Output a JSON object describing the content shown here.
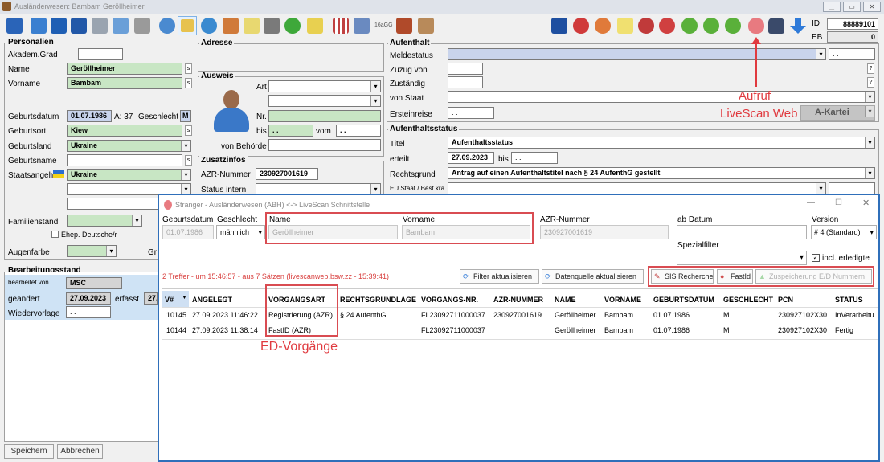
{
  "window": {
    "title": "Ausländerwesen: Bambam Geröllheimer",
    "win_min": "▁",
    "win_max": "▭",
    "win_close": "✕"
  },
  "toolbar": {
    "id_label": "ID",
    "id_value": "88889101",
    "eb_label": "EB",
    "eb_value": "0",
    "ldap_label": "16aGG"
  },
  "personalien": {
    "title": "Personalien",
    "akadem_label": "Akadem.Grad",
    "name_label": "Name",
    "name_value": "Geröllheimer",
    "vorname_label": "Vorname",
    "vorname_value": "Bambam",
    "geburtsdatum_label": "Geburtsdatum",
    "geburtsdatum_value": "01.07.1986",
    "alter": "A: 37",
    "geschlecht_label": "Geschlecht",
    "geschlecht_value": "M",
    "geburtsort_label": "Geburtsort",
    "geburtsort_value": "Kiew",
    "geburtsland_label": "Geburtsland",
    "geburtsland_value": "Ukraine",
    "geburtsname_label": "Geburtsname",
    "staatsangeh_label": "Staatsangeh.",
    "staatsangeh_value": "Ukraine",
    "familienstand_label": "Familienstand",
    "ehep_label": "Ehep. Deutsche/r",
    "augenfarbe_label": "Augenfarbe",
    "gr_label": "Gr"
  },
  "adresse": {
    "title": "Adresse"
  },
  "ausweis": {
    "title": "Ausweis",
    "art_label": "Art",
    "nr_label": "Nr.",
    "bis_label": "bis",
    "bis_value": ". .",
    "vom_label": "vom",
    "vom_value": ". .",
    "behoerde_label": "von Behörde"
  },
  "zusatz": {
    "title": "Zusatzinfos",
    "azr_label": "AZR-Nummer",
    "azr_value": "230927001619",
    "status_label": "Status intern"
  },
  "aufenthalt": {
    "title": "Aufenthalt",
    "meldestatus_label": "Meldestatus",
    "meldestatus_date": ". .",
    "zuzug_label": "Zuzug von",
    "zustaendig_label": "Zuständig",
    "vonstaat_label": "von Staat",
    "ersteinreise_label": "Ersteinreise",
    "ersteinreise_value": ". .",
    "akartei": "A-Kartei"
  },
  "status": {
    "title": "Aufenthaltsstatus",
    "titel_label": "Titel",
    "titel_value": "Aufenthaltsstatus",
    "erteilt_label": "erteilt",
    "erteilt_value": "27.09.2023",
    "bis_label": "bis",
    "bis_value": ". .",
    "rechtsgrund_label": "Rechtsgrund",
    "rechtsgrund_value": "Antrag auf einen Aufenthaltstitel nach § 24 AufenthG gestellt",
    "eu_label": "EU Staat / Best.kra",
    "eu_date": ". ."
  },
  "bearbeitung": {
    "title": "Bearbeitungsstand",
    "bearbeitet_label": "bearbeitet von",
    "bearbeitet_value": "MSC",
    "geaendert_label": "geändert",
    "geaendert_value": "27.09.2023",
    "erfasst_label": "erfasst",
    "erfasst_value": "27.",
    "wiedervorlage_label": "Wiedervorlage",
    "wiedervorlage_value": ". ."
  },
  "buttons": {
    "speichern": "Speichern",
    "abbrechen": "Abbrechen"
  },
  "annotations": {
    "aufruf": "Aufruf",
    "livescan": "LiveScan Web",
    "ed": "ED-Vorgänge"
  },
  "dialog": {
    "title": "Stranger - Ausländerwesen (ABH) <-> LiveScan Schnittstelle",
    "geburtsdatum_label": "Geburtsdatum",
    "geburtsdatum_value": "01.07.1986",
    "geschlecht_label": "Geschlecht",
    "geschlecht_value": "männlich",
    "name_label": "Name",
    "name_value": "Geröllheimer",
    "vorname_label": "Vorname",
    "vorname_value": "Bambam",
    "azr_label": "AZR-Nummer",
    "azr_value": "230927001619",
    "abdatum_label": "ab Datum",
    "version_label": "Version",
    "version_value": "# 4 (Standard)",
    "spezialfilter_label": "Spezialfilter",
    "incl_label": "incl. erledigte",
    "status_text": "2 Treffer -  um 15:46:57 - aus 7 Sätzen (livescanweb.bsw.zz - 15:39:41)",
    "btn_filter": "Filter aktualisieren",
    "btn_datenquelle": "Datenquelle aktualisieren",
    "btn_sis": "SIS Recherche",
    "btn_fastid": "FastId",
    "btn_zusp": "Zuspeicherung E/D Nummern"
  },
  "table": {
    "headers": [
      "V#",
      "ANGELEGT",
      "VORGANGSART",
      "RECHTSGRUNDLAGE",
      "VORGANGS-NR.",
      "AZR-NUMMER",
      "NAME",
      "VORNAME",
      "GEBURTSDATUM",
      "GESCHLECHT",
      "PCN",
      "STATUS"
    ],
    "rows": [
      [
        "10145",
        "27.09.2023 11:46:22",
        "Registrierung (AZR)",
        "§ 24 AufenthG",
        "FL23092711000037",
        "230927001619",
        "Geröllheimer",
        "Bambam",
        "01.07.1986",
        "M",
        "230927102X30",
        "InVerarbeitu"
      ],
      [
        "10144",
        "27.09.2023 11:38:14",
        "FastID (AZR)",
        "",
        "FL23092711000037",
        "",
        "Geröllheimer",
        "Bambam",
        "01.07.1986",
        "M",
        "230927102X30",
        "Fertig"
      ]
    ]
  },
  "colors": {
    "accent_red": "#d94c52",
    "dialog_border": "#2f6fba",
    "green_field": "#c8e6c4",
    "blue_field": "#c9d4ec"
  }
}
